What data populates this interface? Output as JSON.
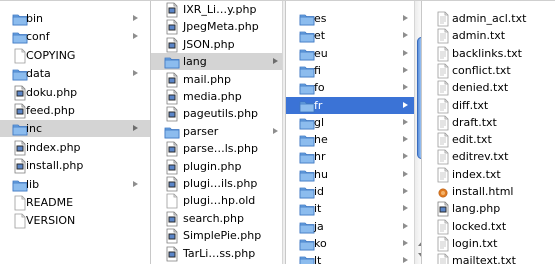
{
  "columns": [
    {
      "name": "column-1",
      "items": [
        {
          "label": "bin",
          "icon": "folder-icon",
          "has_children": true,
          "selected": ""
        },
        {
          "label": "conf",
          "icon": "folder-icon",
          "has_children": true,
          "selected": ""
        },
        {
          "label": "COPYING",
          "icon": "document-icon",
          "has_children": false,
          "selected": ""
        },
        {
          "label": "data",
          "icon": "folder-icon",
          "has_children": true,
          "selected": ""
        },
        {
          "label": "doku.php",
          "icon": "php-file-icon",
          "has_children": false,
          "selected": ""
        },
        {
          "label": "feed.php",
          "icon": "php-file-icon",
          "has_children": false,
          "selected": ""
        },
        {
          "label": "inc",
          "icon": "folder-icon",
          "has_children": true,
          "selected": "gray"
        },
        {
          "label": "index.php",
          "icon": "php-file-icon",
          "has_children": false,
          "selected": ""
        },
        {
          "label": "install.php",
          "icon": "php-file-icon",
          "has_children": false,
          "selected": ""
        },
        {
          "label": "lib",
          "icon": "folder-icon",
          "has_children": true,
          "selected": ""
        },
        {
          "label": "README",
          "icon": "document-icon",
          "has_children": false,
          "selected": ""
        },
        {
          "label": "VERSION",
          "icon": "document-icon",
          "has_children": false,
          "selected": ""
        }
      ]
    },
    {
      "name": "column-2",
      "items": [
        {
          "label": "IXR_Li…y.php",
          "icon": "php-file-icon",
          "has_children": false,
          "selected": ""
        },
        {
          "label": "JpegMeta.php",
          "icon": "php-file-icon",
          "has_children": false,
          "selected": ""
        },
        {
          "label": "JSON.php",
          "icon": "php-file-icon",
          "has_children": false,
          "selected": ""
        },
        {
          "label": "lang",
          "icon": "folder-icon",
          "has_children": true,
          "selected": "gray"
        },
        {
          "label": "mail.php",
          "icon": "php-file-icon",
          "has_children": false,
          "selected": ""
        },
        {
          "label": "media.php",
          "icon": "php-file-icon",
          "has_children": false,
          "selected": ""
        },
        {
          "label": "pageutils.php",
          "icon": "php-file-icon",
          "has_children": false,
          "selected": ""
        },
        {
          "label": "parser",
          "icon": "folder-icon",
          "has_children": true,
          "selected": ""
        },
        {
          "label": "parse…ls.php",
          "icon": "php-file-icon",
          "has_children": false,
          "selected": ""
        },
        {
          "label": "plugin.php",
          "icon": "php-file-icon",
          "has_children": false,
          "selected": ""
        },
        {
          "label": "plugi…ils.php",
          "icon": "php-file-icon",
          "has_children": false,
          "selected": ""
        },
        {
          "label": "plugi…hp.old",
          "icon": "document-icon",
          "has_children": false,
          "selected": ""
        },
        {
          "label": "search.php",
          "icon": "php-file-icon",
          "has_children": false,
          "selected": ""
        },
        {
          "label": "SimplePie.php",
          "icon": "php-file-icon",
          "has_children": false,
          "selected": ""
        },
        {
          "label": "TarLi…ss.php",
          "icon": "php-file-icon",
          "has_children": false,
          "selected": ""
        }
      ]
    },
    {
      "name": "column-3",
      "items": [
        {
          "label": "es",
          "icon": "folder-icon",
          "has_children": true,
          "selected": ""
        },
        {
          "label": "et",
          "icon": "folder-icon",
          "has_children": true,
          "selected": ""
        },
        {
          "label": "eu",
          "icon": "folder-icon",
          "has_children": true,
          "selected": ""
        },
        {
          "label": "fi",
          "icon": "folder-icon",
          "has_children": true,
          "selected": ""
        },
        {
          "label": "fo",
          "icon": "folder-icon",
          "has_children": true,
          "selected": ""
        },
        {
          "label": "fr",
          "icon": "folder-icon",
          "has_children": true,
          "selected": "blue"
        },
        {
          "label": "gl",
          "icon": "folder-icon",
          "has_children": true,
          "selected": ""
        },
        {
          "label": "he",
          "icon": "folder-icon",
          "has_children": true,
          "selected": ""
        },
        {
          "label": "hr",
          "icon": "folder-icon",
          "has_children": true,
          "selected": ""
        },
        {
          "label": "hu",
          "icon": "folder-icon",
          "has_children": true,
          "selected": ""
        },
        {
          "label": "id",
          "icon": "folder-icon",
          "has_children": true,
          "selected": ""
        },
        {
          "label": "it",
          "icon": "folder-icon",
          "has_children": true,
          "selected": ""
        },
        {
          "label": "ja",
          "icon": "folder-icon",
          "has_children": true,
          "selected": ""
        },
        {
          "label": "ko",
          "icon": "folder-icon",
          "has_children": true,
          "selected": ""
        },
        {
          "label": "lt",
          "icon": "folder-icon",
          "has_children": true,
          "selected": ""
        }
      ]
    },
    {
      "name": "column-4",
      "items": [
        {
          "label": "admin_acl.txt",
          "icon": "text-file-icon",
          "has_children": false,
          "selected": ""
        },
        {
          "label": "admin.txt",
          "icon": "text-file-icon",
          "has_children": false,
          "selected": ""
        },
        {
          "label": "backlinks.txt",
          "icon": "text-file-icon",
          "has_children": false,
          "selected": ""
        },
        {
          "label": "conflict.txt",
          "icon": "text-file-icon",
          "has_children": false,
          "selected": ""
        },
        {
          "label": "denied.txt",
          "icon": "text-file-icon",
          "has_children": false,
          "selected": ""
        },
        {
          "label": "diff.txt",
          "icon": "text-file-icon",
          "has_children": false,
          "selected": ""
        },
        {
          "label": "draft.txt",
          "icon": "text-file-icon",
          "has_children": false,
          "selected": ""
        },
        {
          "label": "edit.txt",
          "icon": "text-file-icon",
          "has_children": false,
          "selected": ""
        },
        {
          "label": "editrev.txt",
          "icon": "text-file-icon",
          "has_children": false,
          "selected": ""
        },
        {
          "label": "index.txt",
          "icon": "text-file-icon",
          "has_children": false,
          "selected": ""
        },
        {
          "label": "install.html",
          "icon": "html-file-icon",
          "has_children": false,
          "selected": ""
        },
        {
          "label": "lang.php",
          "icon": "php-file-icon",
          "has_children": false,
          "selected": ""
        },
        {
          "label": "locked.txt",
          "icon": "text-file-icon",
          "has_children": false,
          "selected": ""
        },
        {
          "label": "login.txt",
          "icon": "text-file-icon",
          "has_children": false,
          "selected": ""
        },
        {
          "label": "mailtext.txt",
          "icon": "text-file-icon",
          "has_children": false,
          "selected": ""
        }
      ]
    }
  ],
  "colors": {
    "selection_active": "#3b73d6",
    "selection_inactive": "#d4d4d4",
    "folder_blue": "#6ea6e3"
  }
}
